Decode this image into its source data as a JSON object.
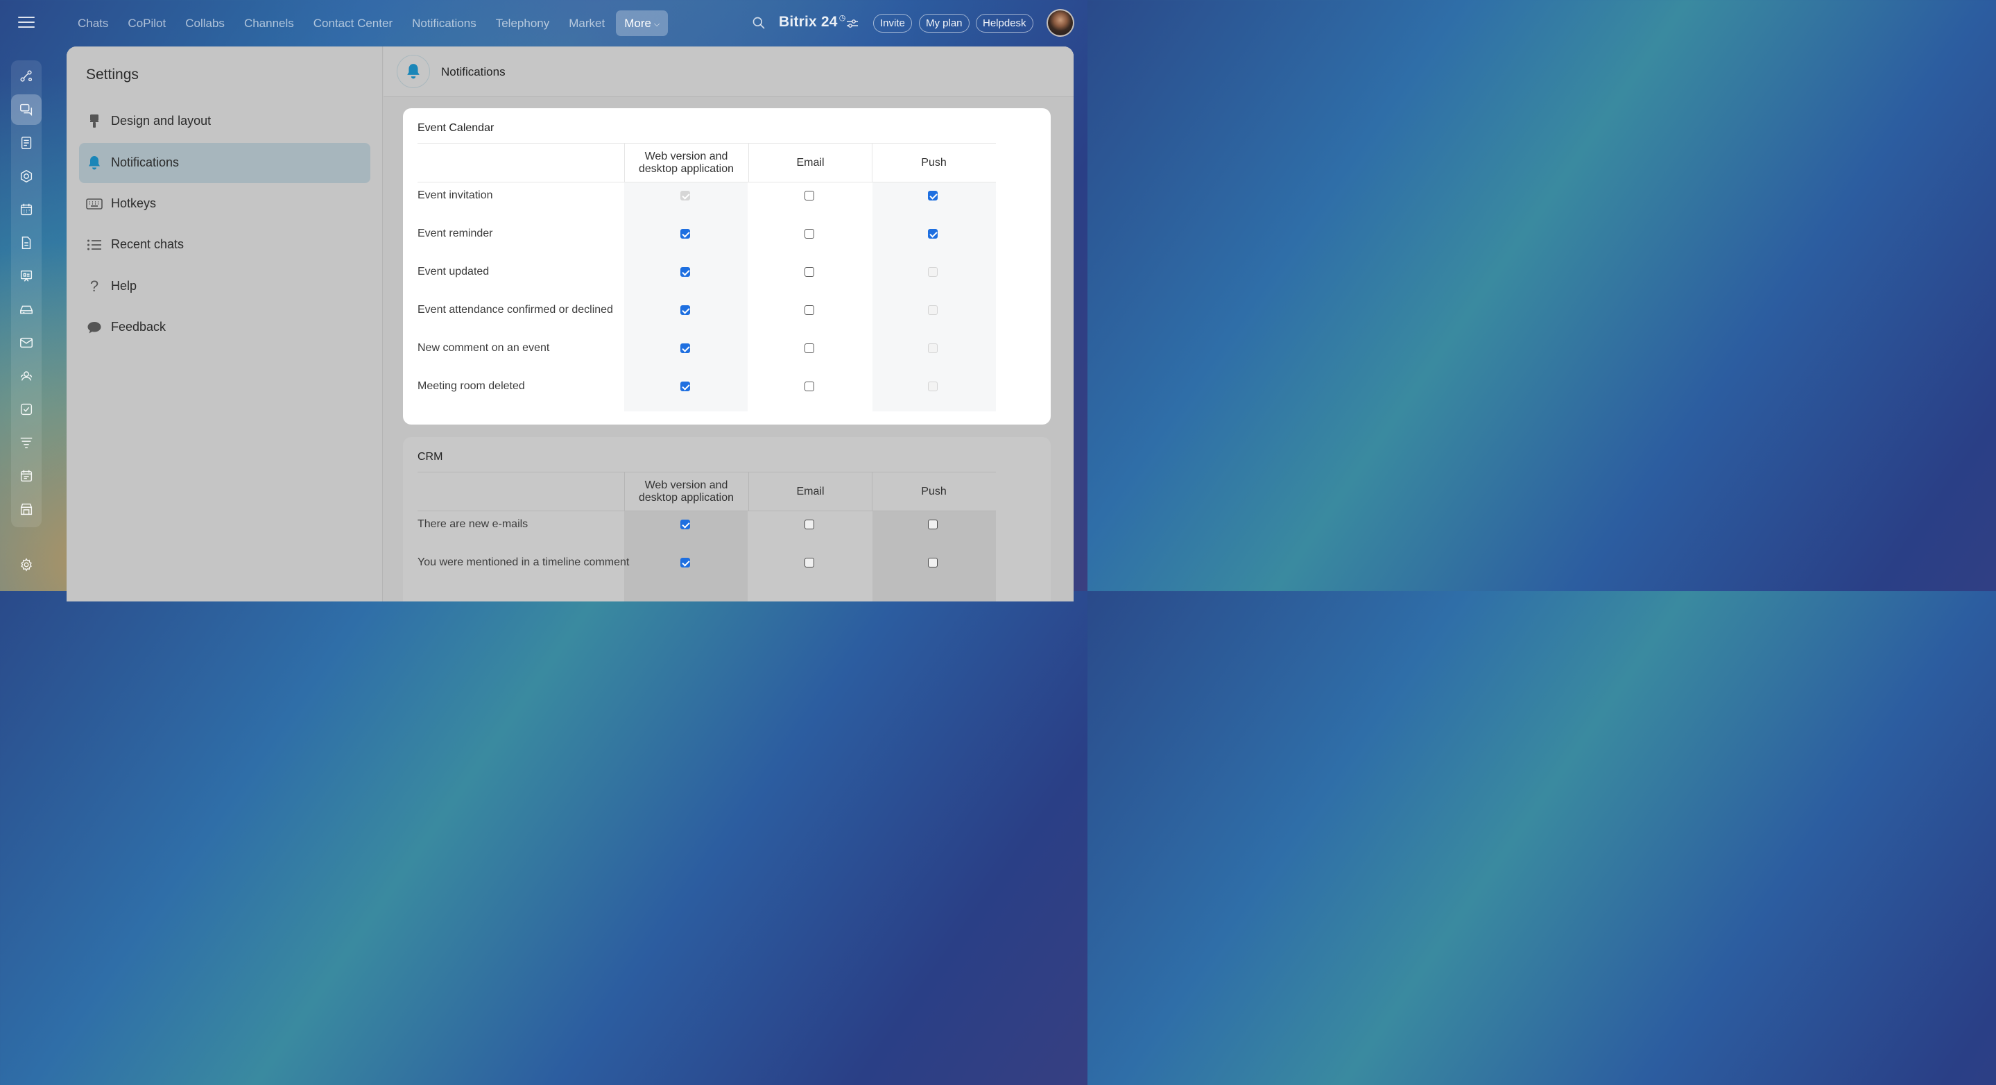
{
  "top_nav": {
    "items": [
      "Chats",
      "CoPilot",
      "Collabs",
      "Channels",
      "Contact Center",
      "Notifications",
      "Telephony",
      "Market"
    ],
    "more_label": "More"
  },
  "brand": {
    "name": "Bitrix 24",
    "clock_icon": "clock-icon"
  },
  "header_buttons": {
    "invite": "Invite",
    "my_plan": "My plan",
    "helpdesk": "Helpdesk"
  },
  "rail_icons": [
    "activity-stream-icon",
    "chat-bubbles-icon",
    "feed-icon",
    "crm-icon",
    "calendar-icon",
    "document-icon",
    "presentation-icon",
    "drive-icon",
    "mail-icon",
    "users-icon",
    "tasks-icon",
    "funnel-icon",
    "schedule-icon",
    "store-icon",
    "settings-gear-icon"
  ],
  "settings": {
    "title": "Settings",
    "menu": [
      {
        "label": "Design and layout",
        "icon": "paint-brush-icon",
        "active": false
      },
      {
        "label": "Notifications",
        "icon": "bell-icon",
        "active": true
      },
      {
        "label": "Hotkeys",
        "icon": "keyboard-icon",
        "active": false
      },
      {
        "label": "Recent chats",
        "icon": "list-icon",
        "active": false
      },
      {
        "label": "Help",
        "icon": "question-icon",
        "active": false
      },
      {
        "label": "Feedback",
        "icon": "speech-bubble-icon",
        "active": false
      }
    ]
  },
  "content": {
    "title": "Notifications",
    "columns": [
      "Web version and desktop application",
      "Email",
      "Push"
    ],
    "sections": [
      {
        "title": "Event Calendar",
        "rows": [
          {
            "label": "Event invitation",
            "web": "disabled-checked",
            "email": "unchecked",
            "push": "checked"
          },
          {
            "label": "Event reminder",
            "web": "checked",
            "email": "unchecked",
            "push": "checked"
          },
          {
            "label": "Event updated",
            "web": "checked",
            "email": "unchecked",
            "push": "disabled"
          },
          {
            "label": "Event attendance confirmed or declined",
            "web": "checked",
            "email": "unchecked",
            "push": "disabled"
          },
          {
            "label": "New comment on an event",
            "web": "checked",
            "email": "unchecked",
            "push": "disabled"
          },
          {
            "label": "Meeting room deleted",
            "web": "checked",
            "email": "unchecked",
            "push": "disabled"
          }
        ]
      },
      {
        "title": "CRM",
        "rows": [
          {
            "label": "There are new e-mails",
            "web": "checked",
            "email": "unchecked",
            "push": "unchecked"
          },
          {
            "label": "You were mentioned in a timeline comment",
            "web": "checked",
            "email": "unchecked",
            "push": "unchecked"
          }
        ]
      }
    ]
  },
  "colors": {
    "accent": "#1e6fe0",
    "active_menu": "#a7b6bd",
    "bell": "#1a86b8"
  }
}
